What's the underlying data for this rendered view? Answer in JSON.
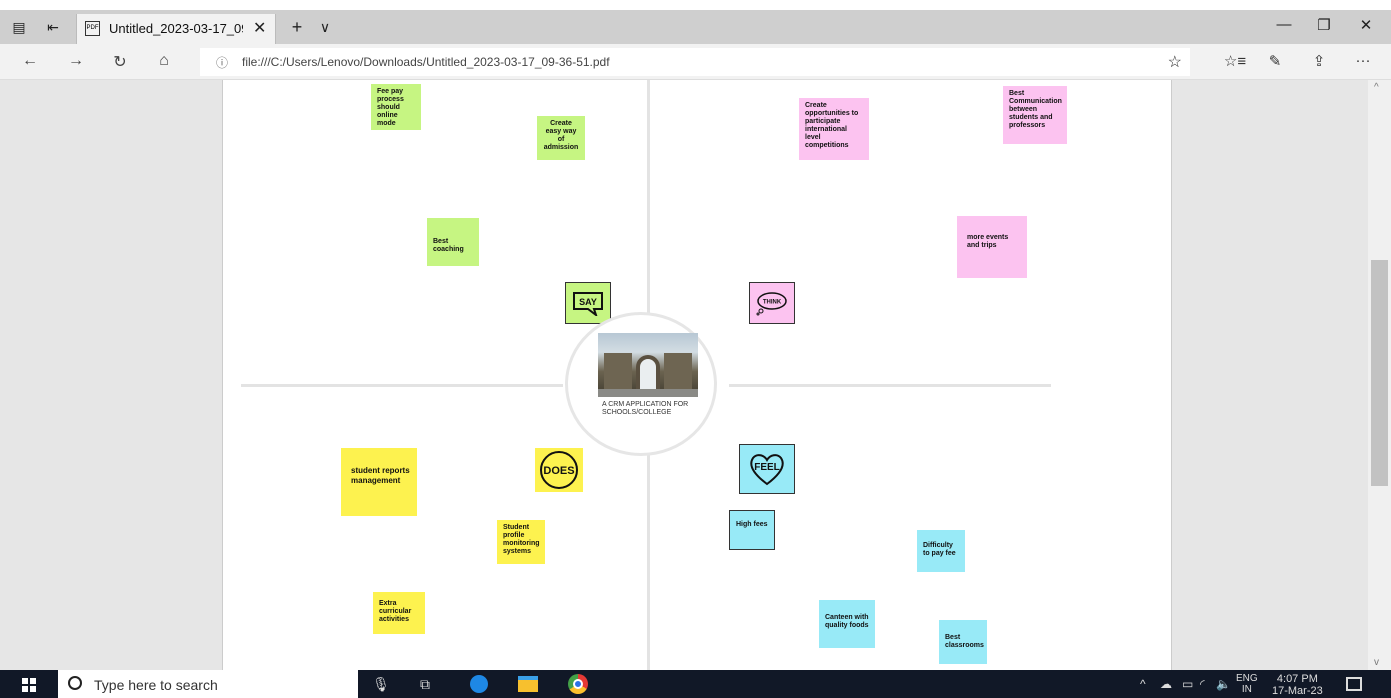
{
  "browser": {
    "tab_title": "Untitled_2023-03-17_09",
    "tab_close_symbol": "✕",
    "new_tab_symbol": "+",
    "tab_dropdown_symbol": "∨",
    "pdf_label": "PDF",
    "url": "file:///C:/Users/Lenovo/Downloads/Untitled_2023-03-17_09-36-51.pdf",
    "window_controls": {
      "minimize": "—",
      "maximize": "❐",
      "close": "✕"
    },
    "nav": {
      "back": "←",
      "forward": "→",
      "refresh": "↻",
      "home": "⌂"
    },
    "toolbar": {
      "favorites": "☆",
      "favorites_bar": "☆≡",
      "pen": "✎",
      "share": "⇪",
      "more": "···"
    }
  },
  "empathy_map": {
    "center_caption": "A CRM APPLICATION FOR SCHOOLS/COLLEGE",
    "badges": {
      "say": "SAY",
      "think": "THINK",
      "does": "DOES",
      "feel": "FEEL"
    },
    "say_notes": [
      "Fee pay process should online mode",
      "Create easy way of admission",
      "Best coaching"
    ],
    "think_notes": [
      "Create opportunities to participate international level competitions",
      "Best Communication between students and professors",
      "more events and trips"
    ],
    "does_notes": [
      "student reports management",
      "Student profile monitoring systems",
      "Extra curricular activities"
    ],
    "feel_notes": [
      "High fees",
      "Difficulty to pay fee",
      "Canteen with quality foods",
      "Best classrooms"
    ]
  },
  "taskbar": {
    "search_placeholder": "Type here to search",
    "lang_line1": "ENG",
    "lang_line2": "IN",
    "time": "4:07 PM",
    "date": "17-Mar-23"
  },
  "colors": {
    "say": "#c6f582",
    "think": "#fcc3f0",
    "does": "#fdf24f",
    "feel": "#98eaf7"
  }
}
